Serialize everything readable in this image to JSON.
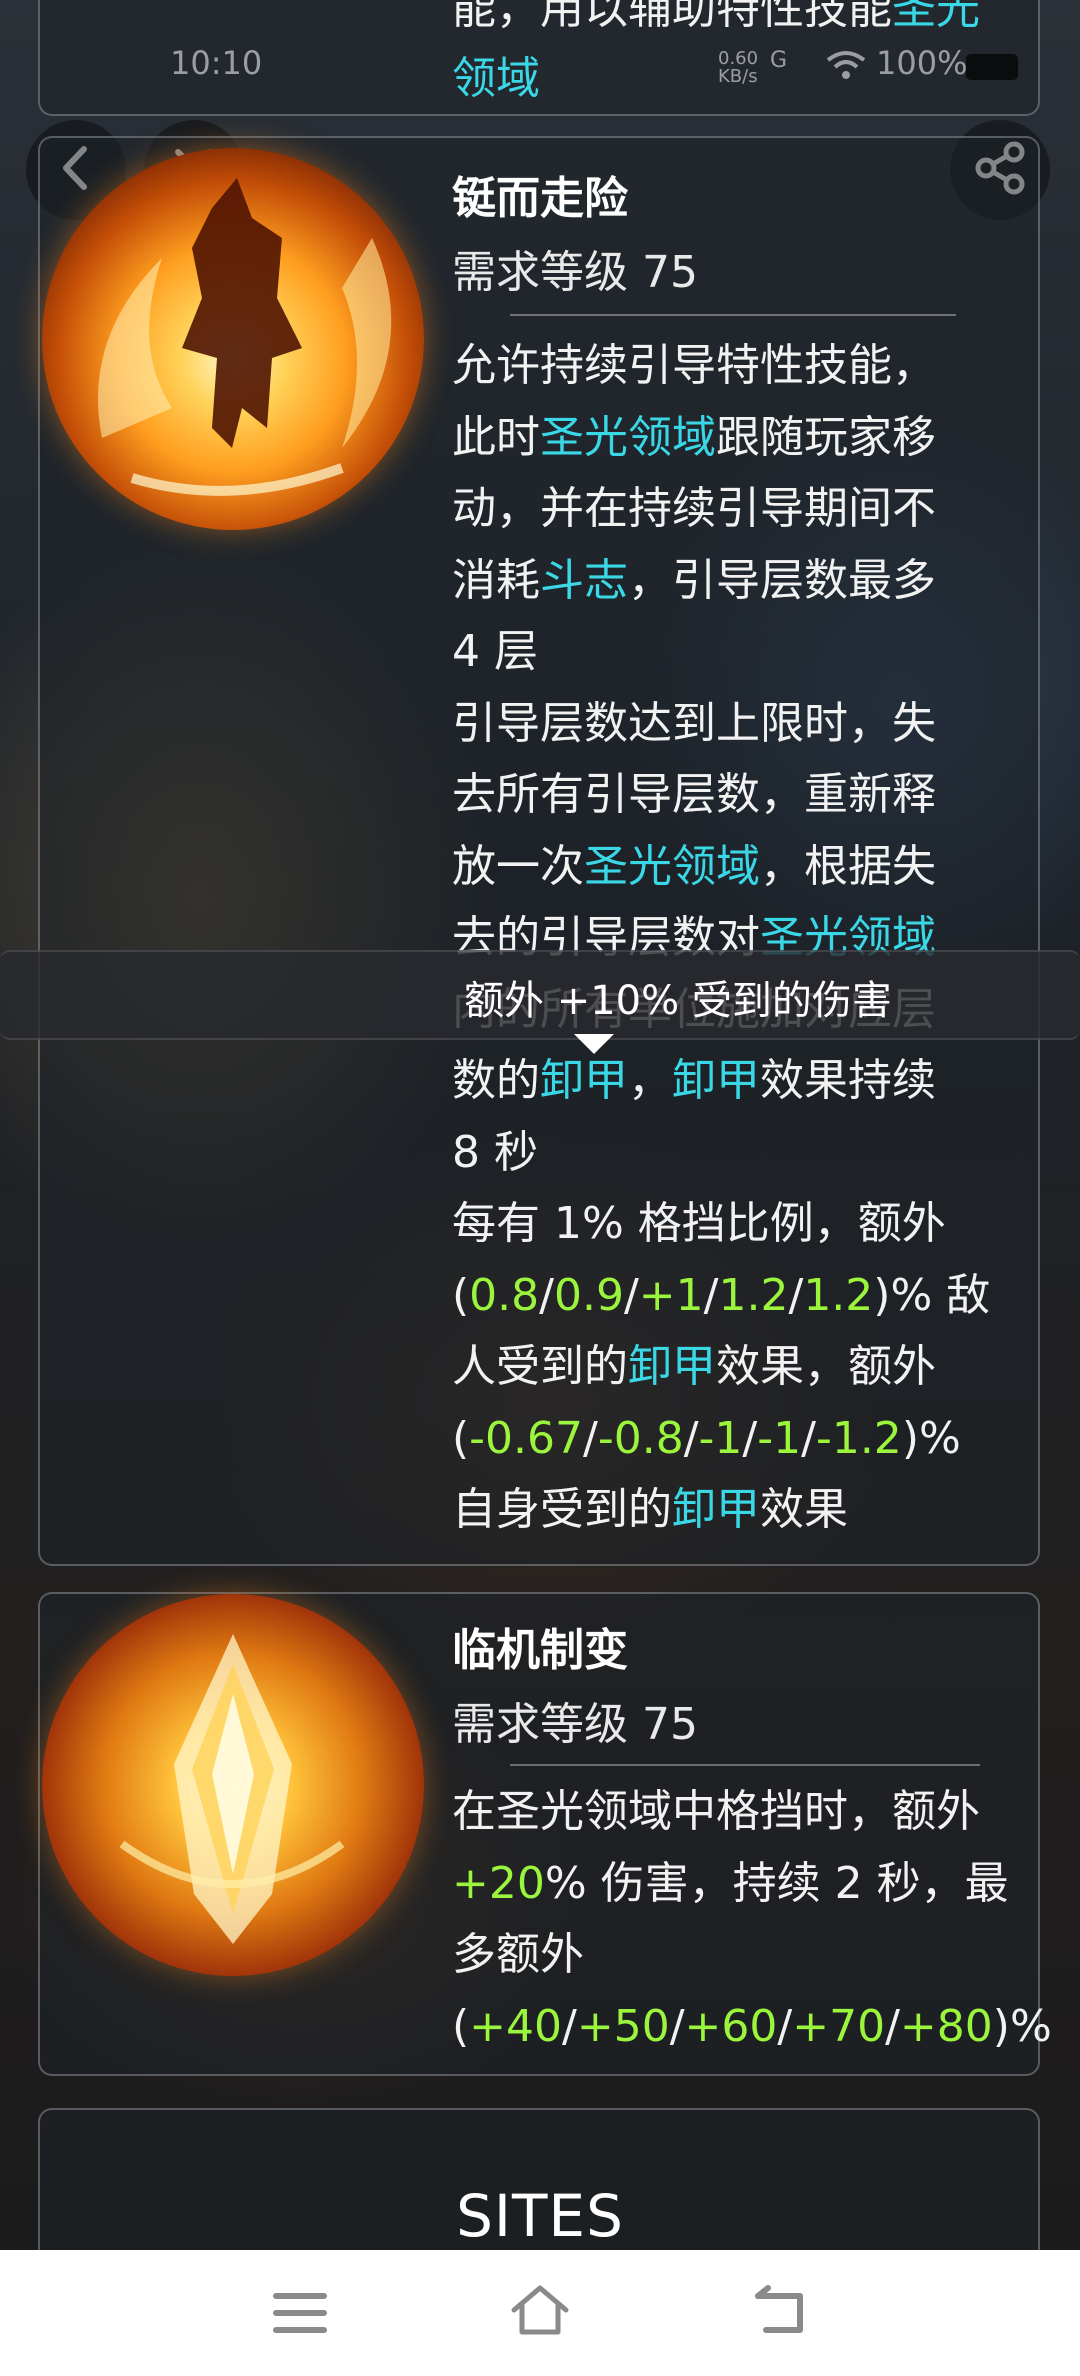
{
  "status_bar": {
    "time": "10:10",
    "net_speed": "0.60 KB/s",
    "signal": "G",
    "battery": "100%"
  },
  "top_card": {
    "text_line1_prefix": "能，用以辅助特性技能",
    "text_line1_highlight": "圣光",
    "text_line2_highlight": "领域"
  },
  "skill1": {
    "title": "铤而走险",
    "requirement": "需求等级 75",
    "lines": [
      [
        {
          "t": "允许持续引导特性技能，",
          "c": ""
        }
      ],
      [
        {
          "t": "此时",
          "c": ""
        },
        {
          "t": "圣光领域",
          "c": "cy"
        },
        {
          "t": "跟随玩家移",
          "c": ""
        }
      ],
      [
        {
          "t": "动，并在持续引导期间不",
          "c": ""
        }
      ],
      [
        {
          "t": "消耗",
          "c": ""
        },
        {
          "t": "斗志",
          "c": "cy"
        },
        {
          "t": "，引导层数最多",
          "c": ""
        }
      ],
      [
        {
          "t": "4 层",
          "c": ""
        }
      ],
      [
        {
          "t": "引导层数达到上限时，失",
          "c": ""
        }
      ],
      [
        {
          "t": "去所有引导层数，重新释",
          "c": ""
        }
      ],
      [
        {
          "t": "放一次",
          "c": ""
        },
        {
          "t": "圣光领域",
          "c": "cy"
        },
        {
          "t": "，根据失",
          "c": ""
        }
      ],
      [
        {
          "t": "去的引导层数对",
          "c": ""
        },
        {
          "t": "圣光领域",
          "c": "cy"
        }
      ],
      [
        {
          "t": "内的所有单位施加对应层",
          "c": ""
        }
      ],
      [
        {
          "t": "数的",
          "c": ""
        },
        {
          "t": "卸甲",
          "c": "cy"
        },
        {
          "t": "，",
          "c": ""
        },
        {
          "t": "卸甲",
          "c": "cy"
        },
        {
          "t": "效果持续",
          "c": ""
        }
      ],
      [
        {
          "t": "8 秒",
          "c": ""
        }
      ],
      [
        {
          "t": "每有 1% 格挡比例，额外",
          "c": ""
        }
      ],
      [
        {
          "t": "(",
          "c": ""
        },
        {
          "t": "0.8",
          "c": "gr"
        },
        {
          "t": "/",
          "c": ""
        },
        {
          "t": "0.9",
          "c": "gr"
        },
        {
          "t": "/",
          "c": ""
        },
        {
          "t": "+1",
          "c": "gr"
        },
        {
          "t": "/",
          "c": ""
        },
        {
          "t": "1.2",
          "c": "gr"
        },
        {
          "t": "/",
          "c": ""
        },
        {
          "t": "1.2",
          "c": "gr"
        },
        {
          "t": ")% 敌",
          "c": ""
        }
      ],
      [
        {
          "t": "人受到的",
          "c": ""
        },
        {
          "t": "卸甲",
          "c": "cy"
        },
        {
          "t": "效果，额外",
          "c": ""
        }
      ],
      [
        {
          "t": "(",
          "c": ""
        },
        {
          "t": "-0.67",
          "c": "gr"
        },
        {
          "t": "/",
          "c": ""
        },
        {
          "t": "-0.8",
          "c": "gr"
        },
        {
          "t": "/",
          "c": ""
        },
        {
          "t": "-1",
          "c": "gr"
        },
        {
          "t": "/",
          "c": ""
        },
        {
          "t": "-1",
          "c": "gr"
        },
        {
          "t": "/",
          "c": ""
        },
        {
          "t": "-1.2",
          "c": "gr"
        },
        {
          "t": ")%",
          "c": ""
        }
      ],
      [
        {
          "t": "自身受到的",
          "c": ""
        },
        {
          "t": "卸甲",
          "c": "cy"
        },
        {
          "t": "效果",
          "c": ""
        }
      ]
    ]
  },
  "tooltip": {
    "text": "额外 +10% 受到的伤害"
  },
  "skill2": {
    "title": "临机制变",
    "requirement": "需求等级 75",
    "lines": [
      [
        {
          "t": "在圣光领域中格挡时，额外",
          "c": ""
        }
      ],
      [
        {
          "t": "+20",
          "c": "gr"
        },
        {
          "t": "% 伤害，持续 2 秒，最",
          "c": ""
        }
      ],
      [
        {
          "t": "多额外",
          "c": ""
        }
      ],
      [
        {
          "t": "(",
          "c": ""
        },
        {
          "t": "+40",
          "c": "gr"
        },
        {
          "t": "/",
          "c": ""
        },
        {
          "t": "+50",
          "c": "gr"
        },
        {
          "t": "/",
          "c": ""
        },
        {
          "t": "+60",
          "c": "gr"
        },
        {
          "t": "/",
          "c": ""
        },
        {
          "t": "+70",
          "c": "gr"
        },
        {
          "t": "/",
          "c": ""
        },
        {
          "t": "+80",
          "c": "gr"
        },
        {
          "t": ")%",
          "c": ""
        }
      ]
    ]
  },
  "sites": {
    "label": "SITES"
  },
  "colors": {
    "highlight_cyan": "#3ad8e6",
    "value_green": "#9bf53c"
  },
  "icons": {
    "back": "chevron-left-icon",
    "close": "close-icon",
    "share": "share-icon",
    "nav_menu": "menu-icon",
    "nav_home": "home-icon",
    "nav_back": "back-icon"
  }
}
